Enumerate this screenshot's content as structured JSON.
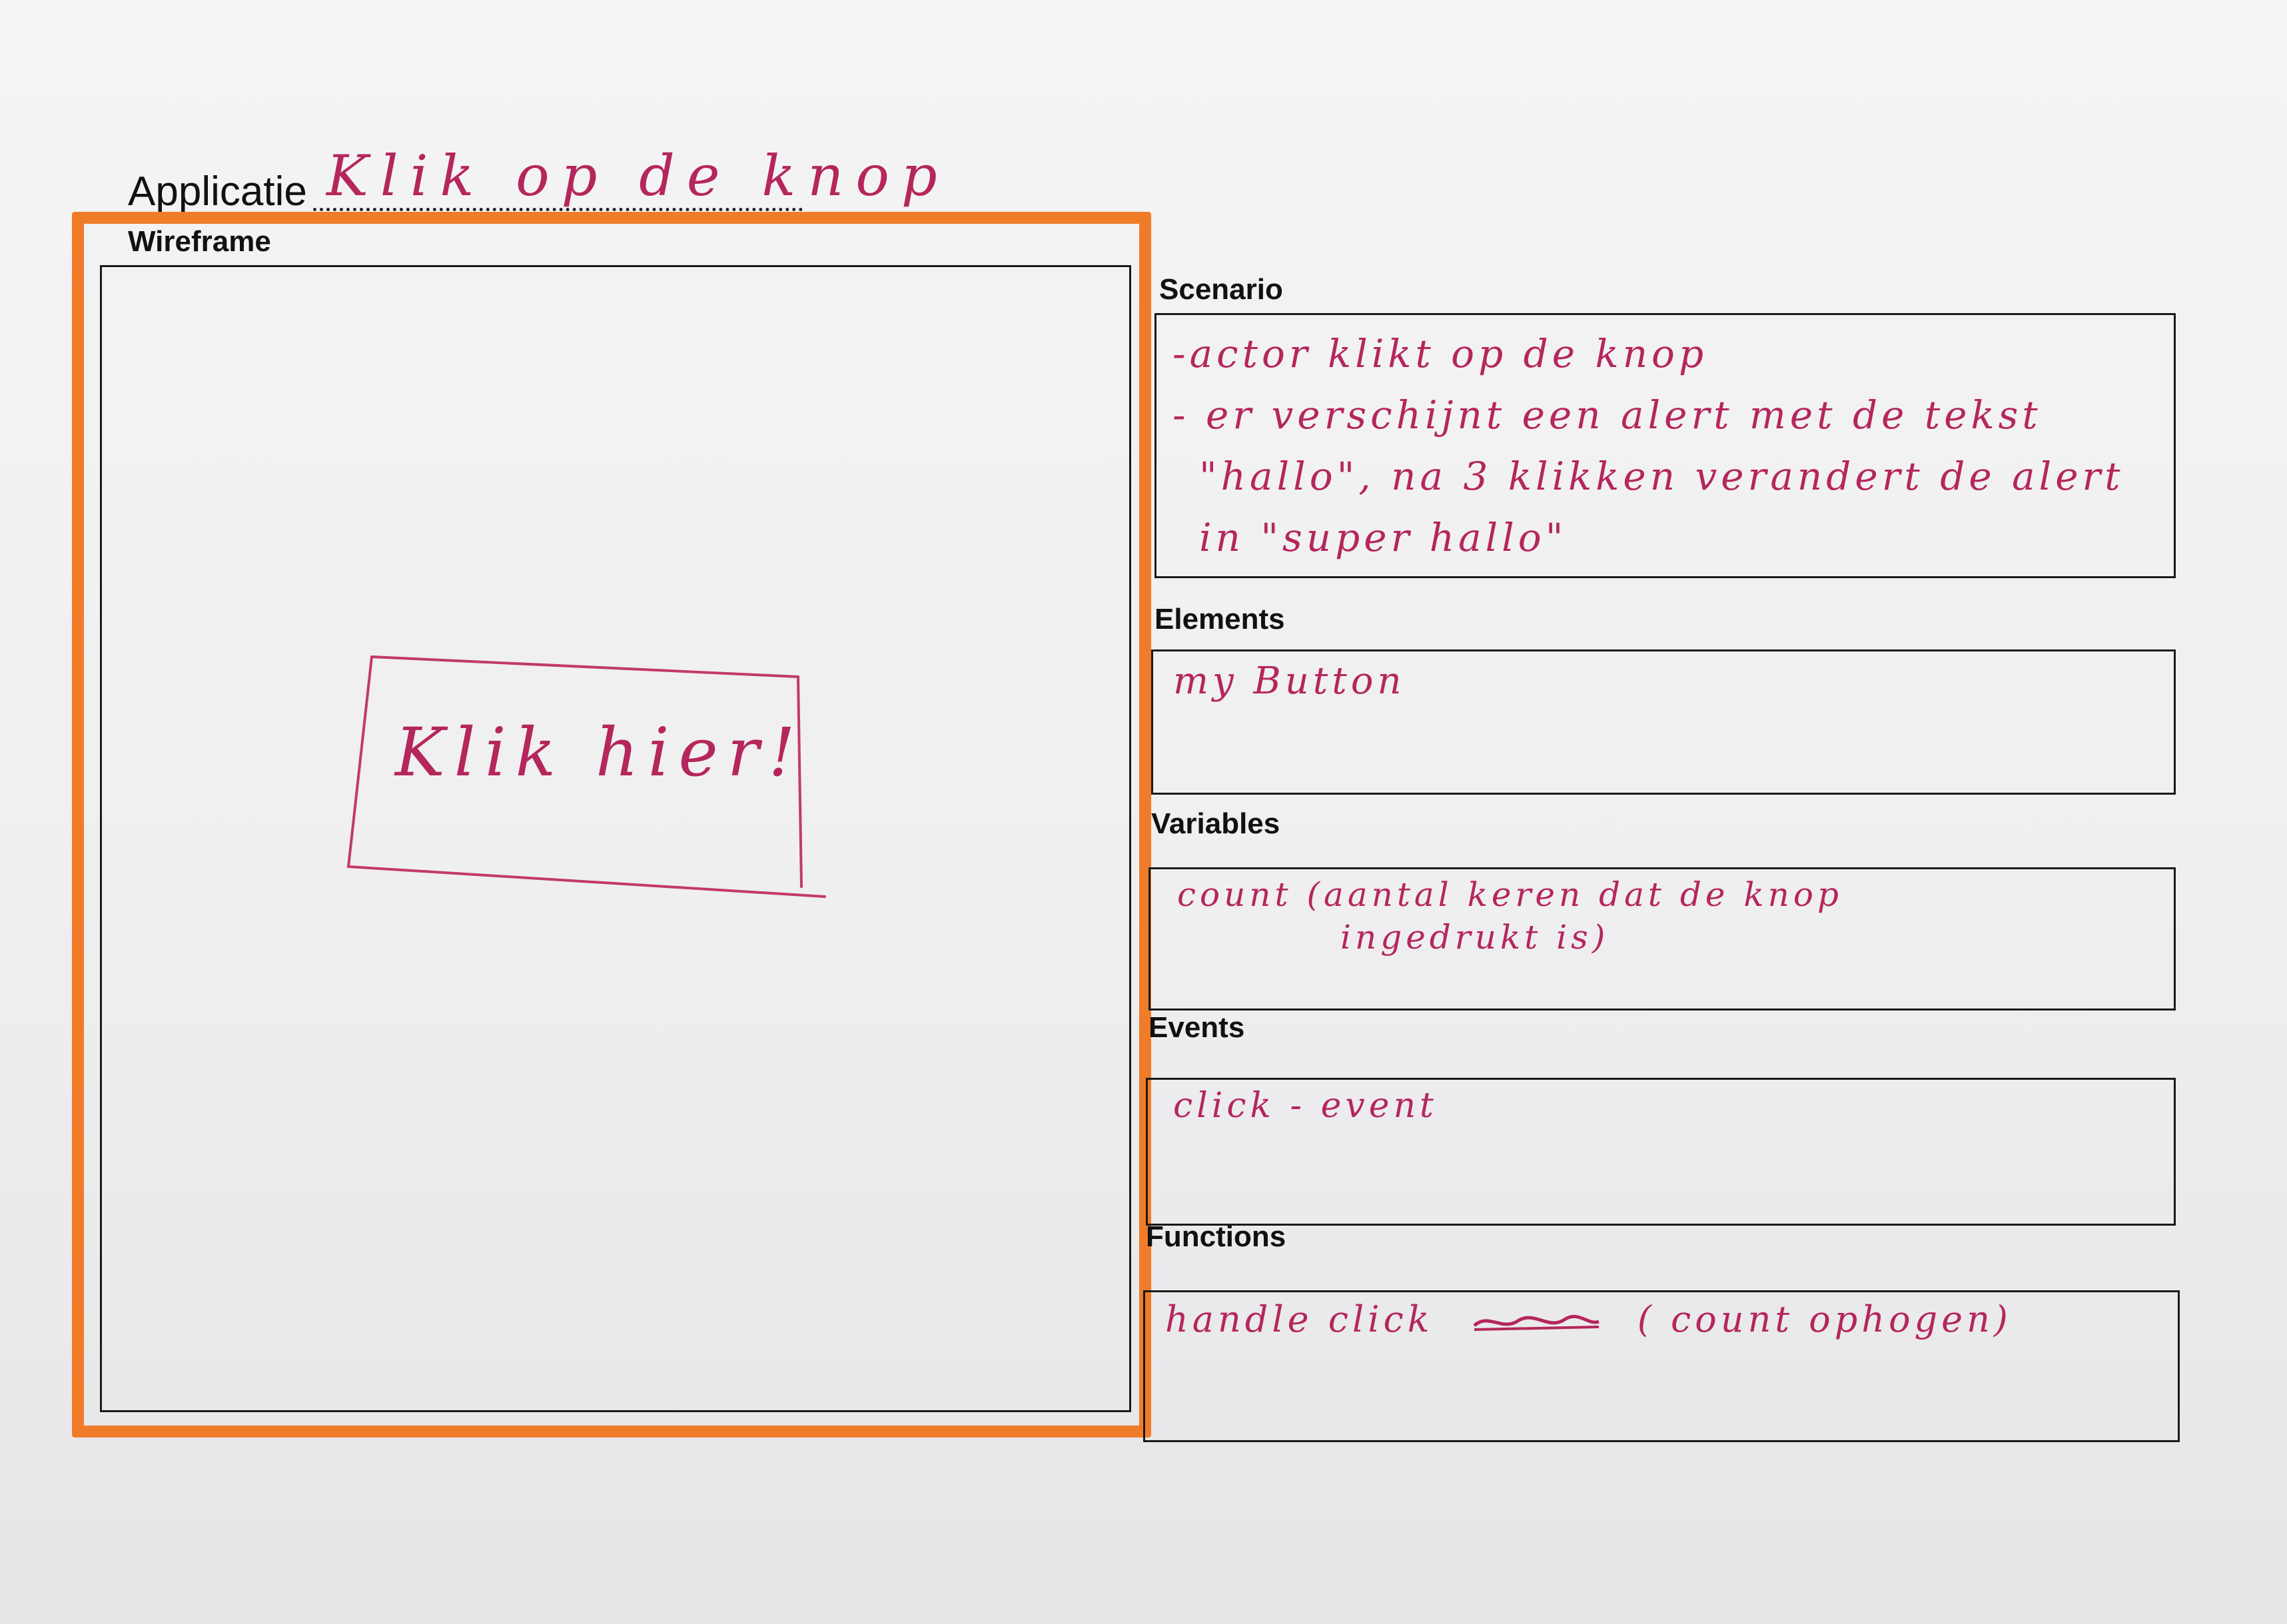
{
  "header": {
    "app_label": "Applicatie",
    "app_name": "Klik op de knop"
  },
  "wireframe": {
    "heading": "Wireframe",
    "button_label": "Klik hier!"
  },
  "sections": {
    "scenario": {
      "heading": "Scenario",
      "lines": [
        "-actor klikt op de knop",
        "- er verschijnt een alert met de tekst",
        "\"hallo\", na 3 klikken verandert de alert",
        "in \"super hallo\""
      ]
    },
    "elements": {
      "heading": "Elements",
      "lines": [
        "my Button"
      ]
    },
    "variables": {
      "heading": "Variables",
      "lines": [
        "count (aantal keren dat de knop",
        "ingedrukt is)"
      ]
    },
    "events": {
      "heading": "Events",
      "lines": [
        "click - event"
      ]
    },
    "functions": {
      "heading": "Functions",
      "line_before": "handle click",
      "line_after": "( count ophogen)"
    }
  },
  "colors": {
    "ink": "#b5265c",
    "highlight": "#f07c2a",
    "print": "#111111"
  }
}
